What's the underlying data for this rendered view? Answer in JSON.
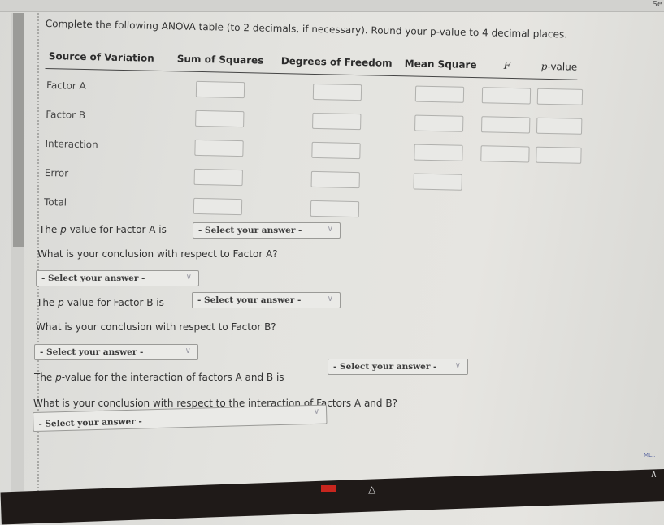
{
  "top": {
    "search_fragment": "Se"
  },
  "instructions": "Complete the following ANOVA table (to 2 decimals, if necessary). Round your p-value to 4 decimal places.",
  "table": {
    "headers": {
      "source": "Source of Variation",
      "ss": "Sum of Squares",
      "df": "Degrees of Freedom",
      "ms": "Mean Square",
      "f": "F",
      "p_prefix": "p",
      "p_suffix": "-value"
    },
    "rows": [
      {
        "label": "Factor A",
        "ss": "",
        "df": "",
        "ms": "",
        "f": "",
        "p": ""
      },
      {
        "label": "Factor B",
        "ss": "",
        "df": "",
        "ms": "",
        "f": "",
        "p": ""
      },
      {
        "label": "Interaction",
        "ss": "",
        "df": "",
        "ms": "",
        "f": "",
        "p": ""
      },
      {
        "label": "Error",
        "ss": "",
        "df": "",
        "ms": ""
      },
      {
        "label": "Total",
        "ss": "",
        "df": ""
      }
    ]
  },
  "questions": {
    "pA_prefix": "The ",
    "p_italic": "p",
    "pA_suffix": "-value for Factor A is",
    "concA": "What is your conclusion with respect to Factor A?",
    "pB_suffix": "-value for Factor B is",
    "concB": "What is your conclusion with respect to Factor B?",
    "pAB_suffix": "-value for the interaction of factors A and B is",
    "concAB": "What is your conclusion with respect to the interaction of Factors A and B?"
  },
  "selects": {
    "placeholder": "- Select your answer -",
    "chevron": "∨"
  },
  "footer": {
    "corner_text": "ML.."
  },
  "tray": {
    "up_arrow": "∧"
  }
}
